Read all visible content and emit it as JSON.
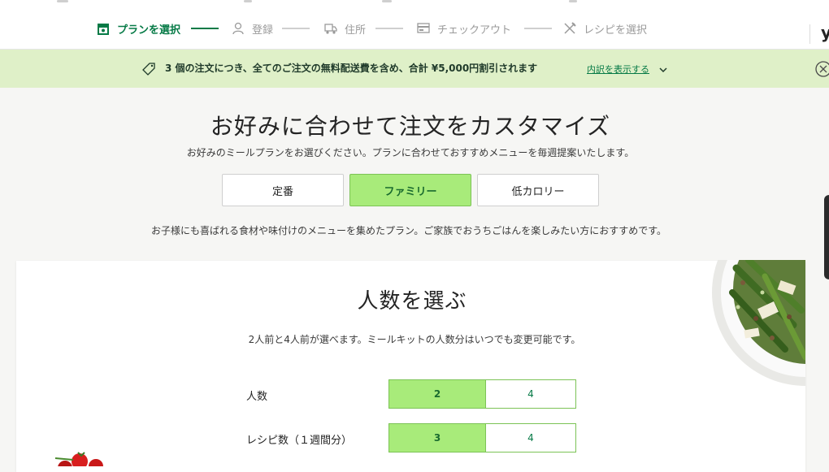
{
  "progress": {
    "steps": [
      {
        "label": "プランを選択",
        "icon": "plan-box-icon",
        "active": true
      },
      {
        "label": "登録",
        "icon": "user-icon",
        "active": false
      },
      {
        "label": "住所",
        "icon": "truck-icon",
        "active": false
      },
      {
        "label": "チェックアウト",
        "icon": "card-icon",
        "active": false
      },
      {
        "label": "レシピを選択",
        "icon": "utensils-icon",
        "active": false
      }
    ],
    "right_cut_text": "y",
    "active_color": "#067a46"
  },
  "promo": {
    "text": "3 個の注文につき、全てのご注文の無料配送費を含め、合計 ¥5,000円割引されます",
    "link": "内訳を表示する",
    "background": "#dff0c8"
  },
  "main": {
    "title": "お好みに合わせて注文をカスタマイズ",
    "subtitle": "お好みのミールプランをお選びください。プランに合わせておすすめメニューを毎週提案いたします。",
    "plans": [
      {
        "label": "定番",
        "selected": false
      },
      {
        "label": "ファミリー",
        "selected": true
      },
      {
        "label": "低カロリー",
        "selected": false
      }
    ],
    "plan_description": "お子様にも喜ばれる食材や味付けのメニューを集めたプラン。ご家族でおうちごはんを楽しみたい方におすすめです。"
  },
  "size_card": {
    "title": "人数を選ぶ",
    "description": "2人前と4人前が選べます。ミールキットの人数分はいつでも変更可能です。",
    "people": {
      "label": "人数",
      "options": [
        "2",
        "4"
      ],
      "selected": "2"
    },
    "recipes": {
      "label": "レシピ数（１週間分）",
      "options": [
        "3",
        "4"
      ],
      "selected": "3"
    }
  },
  "colors": {
    "accent": "#067a46",
    "selected_fill": "#a8eb7a",
    "selected_border": "#7cc356"
  }
}
